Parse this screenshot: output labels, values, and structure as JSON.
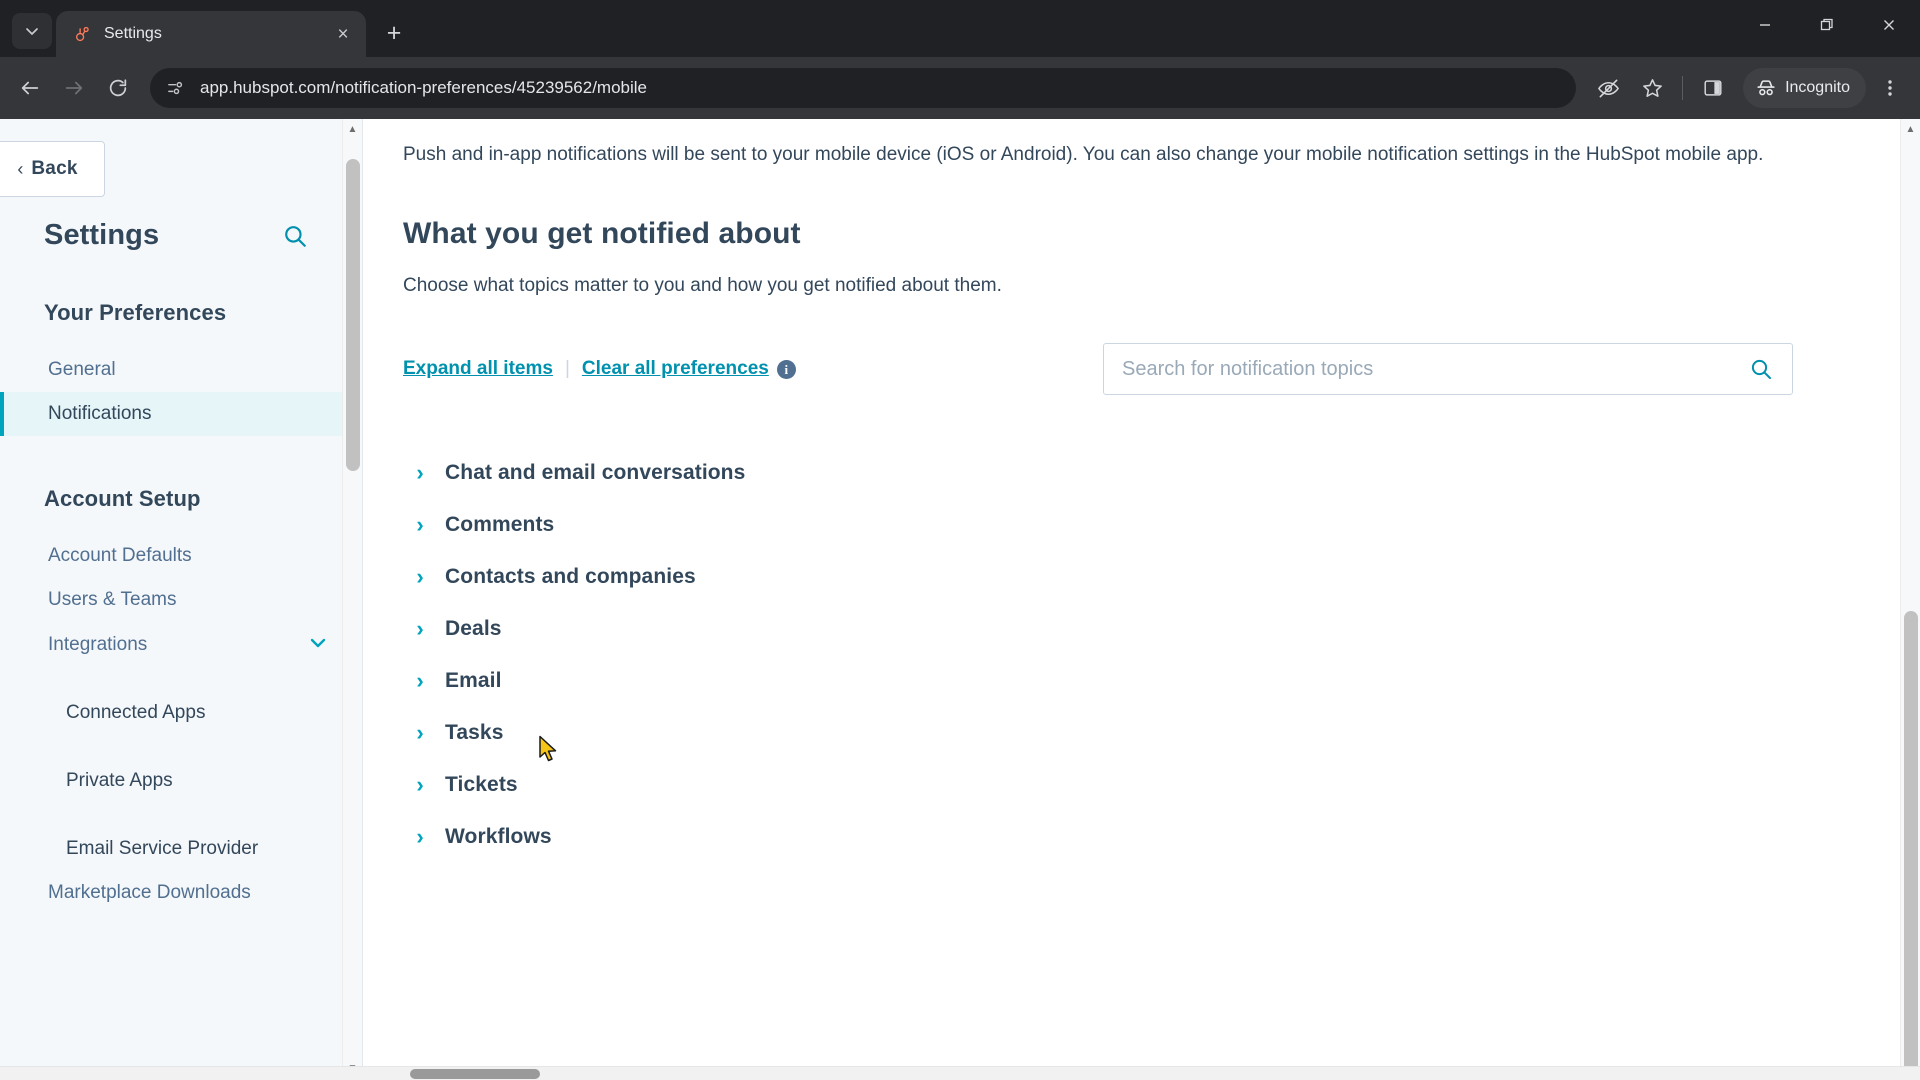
{
  "browser": {
    "tab": {
      "title": "Settings",
      "favicon": "hubspot-sprocket-icon",
      "close_label": "×"
    },
    "newtab_label": "+",
    "tab_search_label": "⌄",
    "window_controls": {
      "minimize": "—",
      "restore": "❐",
      "close": "✕"
    },
    "nav": {
      "back": "←",
      "forward": "→",
      "reload": "⟳"
    },
    "omnibox": {
      "url": "app.hubspot.com/notification-preferences/45239562/mobile",
      "site_icon": "page-info-icon"
    },
    "toolbar_icons": {
      "tracking_protection": "eye-slash-icon",
      "bookmark": "star-icon",
      "side_panel": "side-panel-icon",
      "menu": "three-dot-menu-icon"
    },
    "incognito": {
      "label": "Incognito",
      "icon": "incognito-hat-icon"
    }
  },
  "sidebar": {
    "back_label": "Back",
    "title": "Settings",
    "search_icon": "search-icon",
    "groups": [
      {
        "heading": "Your Preferences",
        "items": [
          {
            "label": "General",
            "active": false,
            "sub": false,
            "chevron": ""
          },
          {
            "label": "Notifications",
            "active": true,
            "sub": false,
            "chevron": ""
          }
        ]
      },
      {
        "heading": "Account Setup",
        "items": [
          {
            "label": "Account Defaults",
            "active": false,
            "sub": false,
            "chevron": ""
          },
          {
            "label": "Users & Teams",
            "active": false,
            "sub": false,
            "chevron": ""
          },
          {
            "label": "Integrations",
            "active": false,
            "sub": false,
            "chevron": "⌄"
          },
          {
            "label": "Connected Apps",
            "active": false,
            "sub": true,
            "chevron": ""
          },
          {
            "label": "Private Apps",
            "active": false,
            "sub": true,
            "chevron": ""
          },
          {
            "label": "Email Service Provider",
            "active": false,
            "sub": true,
            "chevron": ""
          },
          {
            "label": "Marketplace Downloads",
            "active": false,
            "sub": false,
            "chevron": ""
          }
        ]
      }
    ],
    "scroll_up": "▲",
    "scroll_down": "▼"
  },
  "main": {
    "intro": "Push and in-app notifications will be sent to your mobile device (iOS or Android). You can also change your mobile notification settings in the HubSpot mobile app.",
    "heading": "What you get notified about",
    "subheading": "Choose what topics matter to you and how you get notified about them.",
    "expand_all_label": "Expand all items",
    "link_separator": "|",
    "clear_all_label": "Clear all preferences",
    "info_icon_label": "i",
    "search": {
      "placeholder": "Search for notification topics",
      "value": "",
      "icon": "search-icon"
    },
    "topics": [
      {
        "label": "Chat and email conversations",
        "chevron": "›"
      },
      {
        "label": "Comments",
        "chevron": "›"
      },
      {
        "label": "Contacts and companies",
        "chevron": "›"
      },
      {
        "label": "Deals",
        "chevron": "›"
      },
      {
        "label": "Email",
        "chevron": "›"
      },
      {
        "label": "Tasks",
        "chevron": "›"
      },
      {
        "label": "Tickets",
        "chevron": "›"
      },
      {
        "label": "Workflows",
        "chevron": "›"
      }
    ]
  },
  "colors": {
    "accent_teal": "#00a4bd",
    "link_teal": "#0091ae",
    "text_navy": "#33475b",
    "sidebar_bg": "#f5f8fa",
    "active_bg": "#e5f5f8",
    "chrome_bg": "#202124",
    "toolbar_bg": "#35363a"
  }
}
